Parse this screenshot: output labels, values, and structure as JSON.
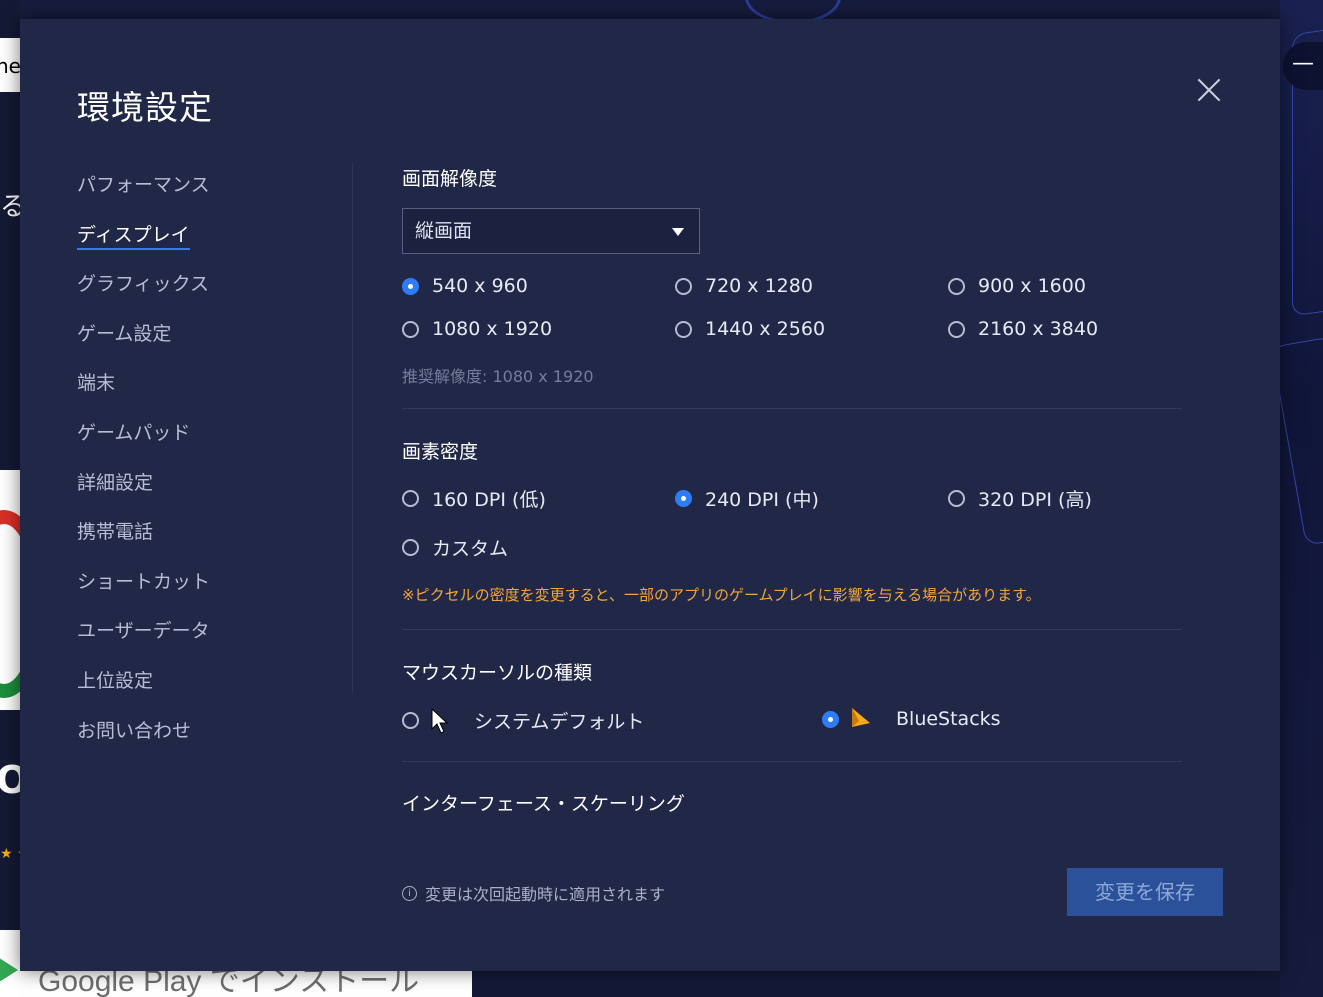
{
  "background": {
    "left_partial_text_top": "ne",
    "left_partial_kana": "る",
    "left_partial_big": "O",
    "bottom_banner_text": "Google Play でインストール"
  },
  "modal": {
    "title": "環境設定",
    "close_icon": "close-icon"
  },
  "sidebar": {
    "items": [
      {
        "label": "パフォーマンス",
        "active": false
      },
      {
        "label": "ディスプレイ",
        "active": true
      },
      {
        "label": "グラフィックス",
        "active": false
      },
      {
        "label": "ゲーム設定",
        "active": false
      },
      {
        "label": "端末",
        "active": false
      },
      {
        "label": "ゲームパッド",
        "active": false
      },
      {
        "label": "詳細設定",
        "active": false
      },
      {
        "label": "携帯電話",
        "active": false
      },
      {
        "label": "ショートカット",
        "active": false
      },
      {
        "label": "ユーザーデータ",
        "active": false
      },
      {
        "label": "上位設定",
        "active": false
      },
      {
        "label": "お問い合わせ",
        "active": false
      }
    ]
  },
  "resolution": {
    "heading": "画面解像度",
    "orientation_selected": "縦画面",
    "options": [
      {
        "label": "540 x 960",
        "checked": true
      },
      {
        "label": "720 x 1280",
        "checked": false
      },
      {
        "label": "900 x 1600",
        "checked": false
      },
      {
        "label": "1080 x 1920",
        "checked": false
      },
      {
        "label": "1440 x 2560",
        "checked": false
      },
      {
        "label": "2160 x 3840",
        "checked": false
      }
    ],
    "recommended": "推奨解像度: 1080 x 1920"
  },
  "density": {
    "heading": "画素密度",
    "options": [
      {
        "label": "160 DPI (低)",
        "checked": false
      },
      {
        "label": "240 DPI (中)",
        "checked": true
      },
      {
        "label": "320 DPI (高)",
        "checked": false
      },
      {
        "label": "カスタム",
        "checked": false
      }
    ],
    "warning": "※ピクセルの密度を変更すると、一部のアプリのゲームプレイに影響を与える場合があります。"
  },
  "cursor": {
    "heading": "マウスカーソルの種類",
    "options": [
      {
        "label": "システムデフォルト",
        "checked": false,
        "icon": "arrow-cursor-icon"
      },
      {
        "label": "BlueStacks",
        "checked": true,
        "icon": "bluestacks-cursor-icon"
      }
    ]
  },
  "scaling": {
    "heading": "インターフェース・スケーリング"
  },
  "footer": {
    "note": "変更は次回起動時に適用されます",
    "info_icon": "info-icon",
    "save_label": "変更を保存"
  },
  "colors": {
    "modal_bg": "#212746",
    "accent": "#2f7df6",
    "warning": "#f2a73b",
    "save_button": "#2a5199"
  }
}
